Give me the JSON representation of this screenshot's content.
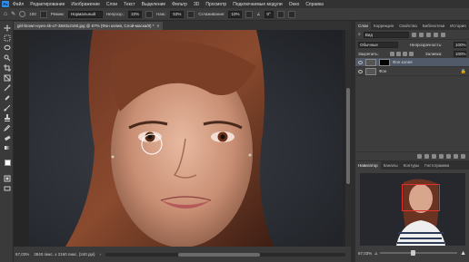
{
  "app": {
    "logo": "Ps",
    "menu": [
      "Файл",
      "Редактирование",
      "Изображение",
      "Слои",
      "Текст",
      "Выделение",
      "Фильтр",
      "3D",
      "Просмотр",
      "Подключаемые модули",
      "Окно",
      "Справка"
    ]
  },
  "options": {
    "brush_size": "100",
    "mode_label": "Режим:",
    "mode_value": "Нормальный",
    "opacity_label": "Непрозр.:",
    "opacity_value": "10%",
    "flow_label": "Наж.:",
    "flow_value": "53%",
    "smoothing_label": "Сглаживание:",
    "smoothing_value": "10%",
    "angle_value": "0°"
  },
  "document": {
    "tab_title": "girl-brown-eyes-4k-o7-3840x2160.jpg @ 67% (Фон копия, Слой-маска/8) *",
    "tab_close": "×"
  },
  "status": {
    "zoom": "67,03%",
    "dimensions": "3840 пикс. x 2160 пикс. (240 ppi)",
    "arrow": "›"
  },
  "panels": {
    "tabs": [
      "Слои",
      "Коррекция",
      "Свойства",
      "Библиотеки",
      "История"
    ],
    "active_tab": "Слои",
    "search_placeholder": "Вид",
    "blend_mode": "Обычные",
    "opacity_label": "Непрозрачность:",
    "opacity_value": "100%",
    "lock_label": "Закрепить:",
    "fill_label": "Заливка:",
    "fill_value": "100%",
    "layers": [
      {
        "name": "Фон копия",
        "selected": true,
        "has_mask": true
      },
      {
        "name": "Фон",
        "selected": false,
        "has_mask": false
      }
    ]
  },
  "navigator": {
    "tabs": [
      "Навигатор",
      "Каналы",
      "Контуры",
      "Гистограмма"
    ],
    "active_tab": "Навигатор",
    "zoom": "67,03%"
  },
  "colors": {
    "accent": "#2d8ceb",
    "view_rect": "#e03030",
    "foreground": "#ffffff",
    "background": "#000000"
  }
}
